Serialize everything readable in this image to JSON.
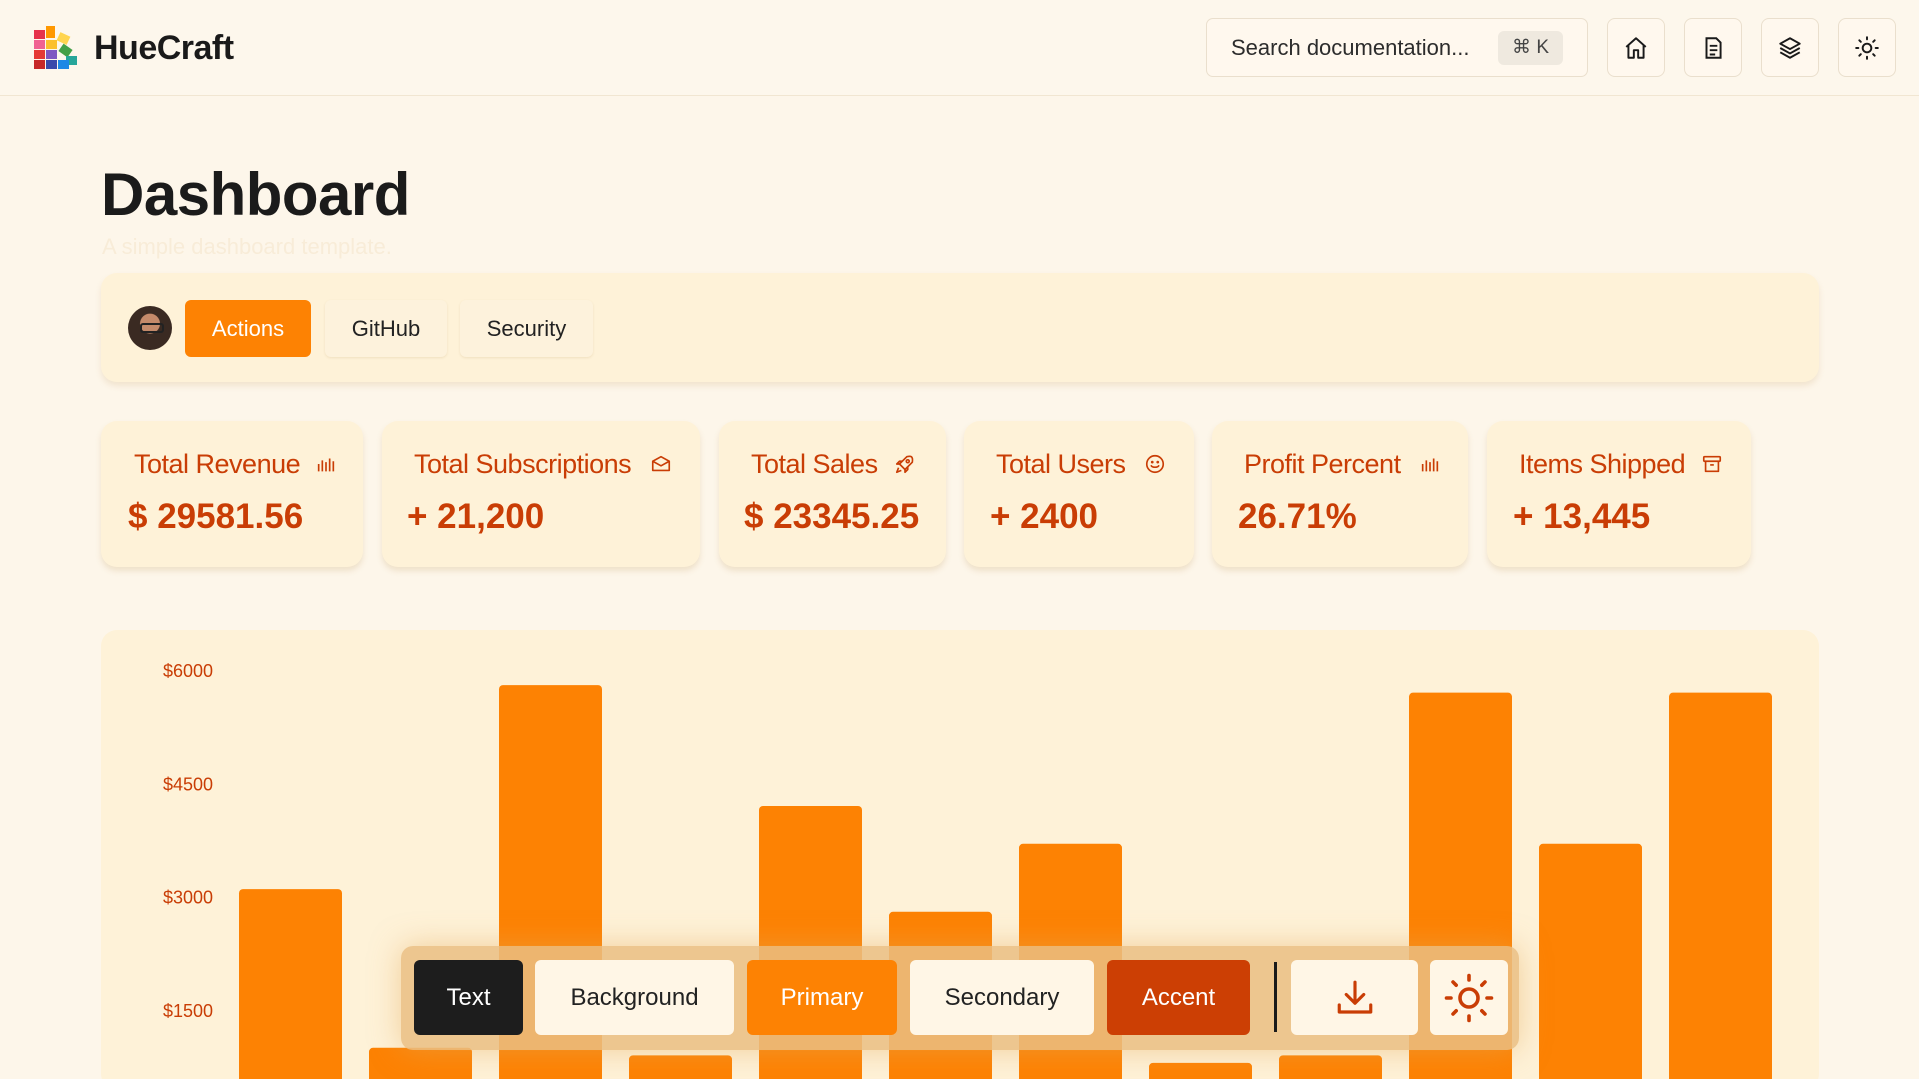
{
  "header": {
    "brand_name": "HueCraft",
    "search_placeholder": "Search documentation...",
    "search_shortcut": "⌘ K",
    "icons": [
      "home-icon",
      "document-icon",
      "layers-icon",
      "sun-icon"
    ]
  },
  "page": {
    "title": "Dashboard",
    "subtitle": "A simple dashboard template."
  },
  "tabs": [
    {
      "label": "Actions",
      "active": true
    },
    {
      "label": "GitHub",
      "active": false
    },
    {
      "label": "Security",
      "active": false
    }
  ],
  "stats": [
    {
      "label": "Total Revenue",
      "value": "$ 29581.56",
      "icon": "bar-chart-icon"
    },
    {
      "label": "Total Subscriptions",
      "value": "+ 21,200",
      "icon": "mail-icon"
    },
    {
      "label": "Total Sales",
      "value": "$ 23345.25",
      "icon": "rocket-icon"
    },
    {
      "label": "Total Users",
      "value": "+ 2400",
      "icon": "smile-icon"
    },
    {
      "label": "Profit Percent",
      "value": "26.71%",
      "icon": "bar-chart-icon"
    },
    {
      "label": "Items Shipped",
      "value": "+ 13,445",
      "icon": "archive-icon"
    }
  ],
  "chart_data": {
    "type": "bar",
    "ylabel_ticks": [
      "$6000",
      "$4500",
      "$3000",
      "$1500"
    ],
    "ylim": [
      0,
      6500
    ],
    "values": [
      3100,
      1000,
      5800,
      900,
      4200,
      2800,
      3700,
      800,
      900,
      5700,
      3700,
      5700
    ],
    "color": "#fd8203",
    "grid": false
  },
  "palette": {
    "buttons": [
      {
        "label": "Text",
        "bg": "#1d1d1d",
        "fg": "#ffffff"
      },
      {
        "label": "Background",
        "bg": "#fff6e6",
        "fg": "#222222"
      },
      {
        "label": "Primary",
        "bg": "#fd8203",
        "fg": "#ffffff"
      },
      {
        "label": "Secondary",
        "bg": "#fff6e6",
        "fg": "#222222"
      },
      {
        "label": "Accent",
        "bg": "#cc3f04",
        "fg": "#ffffff"
      }
    ],
    "icons": [
      "download-icon",
      "sun-icon"
    ]
  },
  "colors": {
    "primary": "#fd8203",
    "accent": "#c93d05",
    "background": "#fdf6ea"
  }
}
